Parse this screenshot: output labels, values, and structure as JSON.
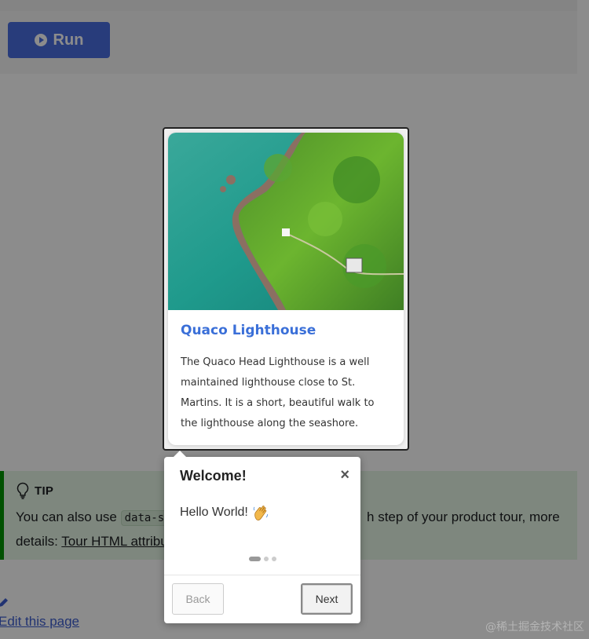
{
  "page": {
    "run_button_label": "Run",
    "tip": {
      "heading": "TIP",
      "text_before": "You can also use ",
      "code": "data-ste",
      "text_after": "h step of your product tour, more",
      "details_label": "details: ",
      "link_text": "Tour HTML attribu"
    },
    "edit_link": "Edit this page"
  },
  "card": {
    "title": "Quaco Lighthouse",
    "description": "The Quaco Head Lighthouse is a well maintained lighthouse close to St. Martins. It is a short, beautiful walk to the lighthouse along the seashore."
  },
  "popover": {
    "title": "Welcome!",
    "close_symbol": "×",
    "body": "Hello World!",
    "emoji_icon": "waving-hand-icon",
    "steps_total": 3,
    "current_step": 1,
    "back_label": "Back",
    "next_label": "Next"
  },
  "watermark": "@稀土掘金技术社区",
  "colors": {
    "run_button": "#4a6ee0",
    "card_title": "#3a6fd8",
    "tip_background": "#e6f6e6",
    "link": "#3d5ecf"
  }
}
